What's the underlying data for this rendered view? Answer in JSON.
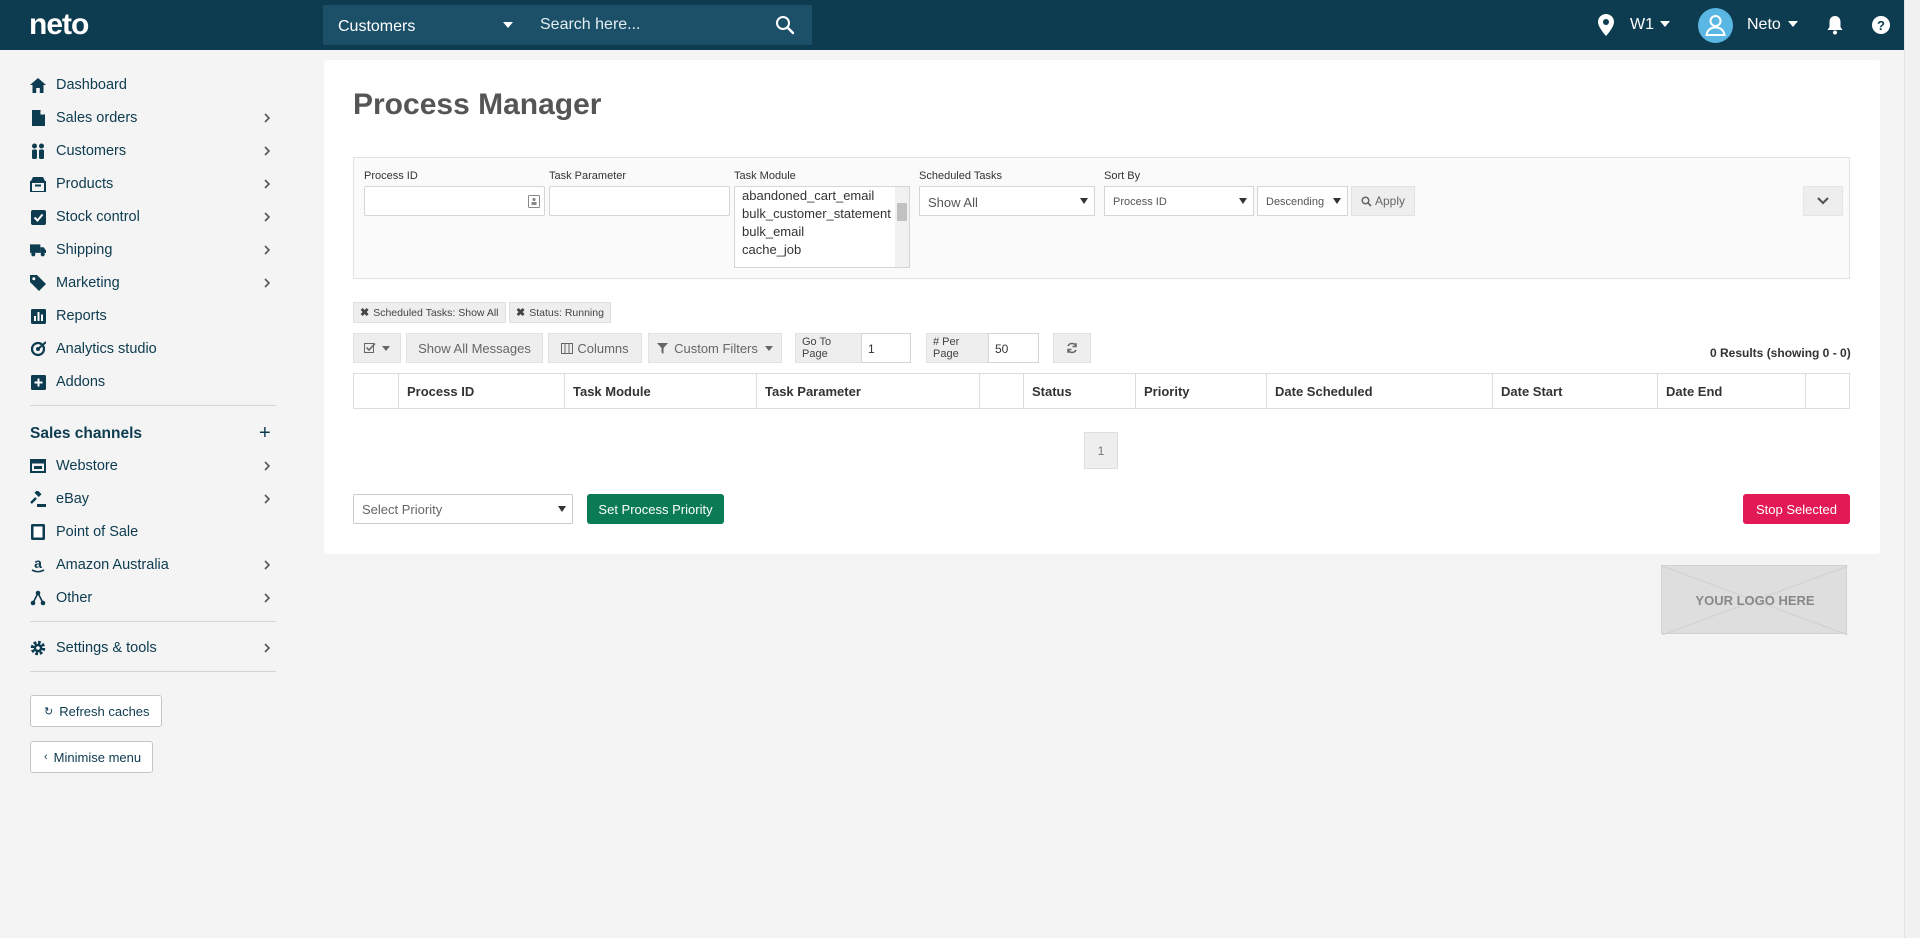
{
  "topbar": {
    "logo": "neto",
    "search_scope": "Customers",
    "search_placeholder": "Search here...",
    "location": "W1",
    "user": "Neto"
  },
  "sidebar": {
    "items": [
      {
        "label": "Dashboard",
        "icon": "home-icon"
      },
      {
        "label": "Sales orders",
        "icon": "document-icon"
      },
      {
        "label": "Customers",
        "icon": "people-icon"
      },
      {
        "label": "Products",
        "icon": "box-icon"
      },
      {
        "label": "Stock control",
        "icon": "checkbox-icon"
      },
      {
        "label": "Shipping",
        "icon": "truck-icon"
      },
      {
        "label": "Marketing",
        "icon": "tag-icon"
      },
      {
        "label": "Reports",
        "icon": "bar-chart-icon"
      },
      {
        "label": "Analytics studio",
        "icon": "analytics-icon"
      },
      {
        "label": "Addons",
        "icon": "plus-square-icon"
      }
    ],
    "channels_title": "Sales channels",
    "channels": [
      {
        "label": "Webstore",
        "icon": "webstore-icon"
      },
      {
        "label": "eBay",
        "icon": "gavel-icon"
      },
      {
        "label": "Point of Sale",
        "icon": "pos-icon"
      },
      {
        "label": "Amazon Australia",
        "icon": "amazon-icon"
      },
      {
        "label": "Other",
        "icon": "share-icon"
      }
    ],
    "settings": "Settings & tools",
    "refresh": "Refresh caches",
    "minimise": "Minimise menu"
  },
  "main": {
    "title": "Process Manager",
    "filters": {
      "process_id_label": "Process ID",
      "task_parameter_label": "Task Parameter",
      "task_module_label": "Task Module",
      "task_module_options": [
        "abandoned_cart_email",
        "bulk_customer_statement",
        "bulk_email",
        "cache_job"
      ],
      "scheduled_tasks_label": "Scheduled Tasks",
      "scheduled_tasks_value": "Show All",
      "sort_by_label": "Sort By",
      "sort_by_value": "Process ID",
      "order_value": "Descending",
      "apply": "Apply"
    },
    "active_filters": [
      "Scheduled Tasks: Show All",
      "Status: Running"
    ],
    "toolbar": {
      "show_all_messages": "Show All Messages",
      "columns": "Columns",
      "custom_filters": "Custom Filters",
      "go_to_page_label": "Go To Page",
      "go_to_page_value": "1",
      "per_page_label": "# Per Page",
      "per_page_value": "50"
    },
    "results": "0 Results (showing 0 - 0)",
    "columns": [
      "Process ID",
      "Task Module",
      "Task Parameter",
      "",
      "Status",
      "Priority",
      "Date Scheduled",
      "Date Start",
      "Date End"
    ],
    "page": "1",
    "priority_placeholder": "Select Priority",
    "set_priority": "Set Process Priority",
    "stop_selected": "Stop Selected"
  },
  "logo_placeholder": "YOUR LOGO HERE",
  "colors": {
    "topbar": "#0d3b4f",
    "primary_green": "#0a7b55",
    "danger_red": "#e21955",
    "avatar": "#5ab7e4"
  }
}
